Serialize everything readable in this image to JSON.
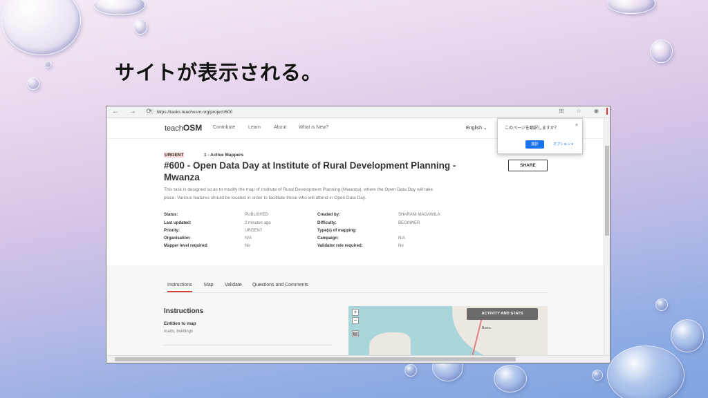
{
  "slide": {
    "title": "サイトが表示される。"
  },
  "browser": {
    "url": "https://tasks.teachosm.org/project/600",
    "nav_glyphs": "← → ⟳",
    "lock_glyph": "ⓘ",
    "right_glyphs": "⊞ ☆ ◉"
  },
  "site": {
    "logo_prefix": "teach",
    "logo_suffix": "OSM",
    "nav": [
      "Contribute",
      "Learn",
      "About",
      "What is New?"
    ],
    "language": "English ⌄"
  },
  "translate_popup": {
    "message": "このページを翻訳しますか？",
    "close": "×",
    "translate_label": "翻訳",
    "options_label": "オプション ▾"
  },
  "project": {
    "priority_badge": "URGENT",
    "mappers": "1 - Active Mappers",
    "title": "#600 - Open Data Day at Institute of Rural Development Planning - Mwanza",
    "share_label": "SHARE",
    "description": "This task is designed so as to modify the map of Institute of Rural Development Planning (Mwanza), where the Open Data Day will take place. Various features should be located in order to facilitate those who will attend in Open Data Day.",
    "meta_left": [
      {
        "label": "Status:",
        "value": "PUBLISHED"
      },
      {
        "label": "Last updated:",
        "value": "2 minutes ago"
      },
      {
        "label": "Priority:",
        "value": "URGENT"
      },
      {
        "label": "Organisation:",
        "value": "N/A"
      },
      {
        "label": "Mapper level required:",
        "value": "No"
      }
    ],
    "meta_right": [
      {
        "label": "Created by:",
        "value": "SHARANI MAGAWILA"
      },
      {
        "label": "Difficulty:",
        "value": "BEGINNER"
      },
      {
        "label": "Type(s) of mapping:",
        "value": ""
      },
      {
        "label": "Campaign:",
        "value": "N/A"
      },
      {
        "label": "Validator role required:",
        "value": "No"
      }
    ]
  },
  "tabs": [
    "Instructions",
    "Map",
    "Validate",
    "Questions and Comments"
  ],
  "instructions": {
    "heading": "Instructions",
    "entities_heading": "Entities to map",
    "entities_value": "roads, buildings"
  },
  "map": {
    "zoom_in": "+",
    "zoom_out": "−",
    "layers": "▤",
    "activity_label": "ACTIVITY AND STATS",
    "town_label": "Bwiru"
  }
}
